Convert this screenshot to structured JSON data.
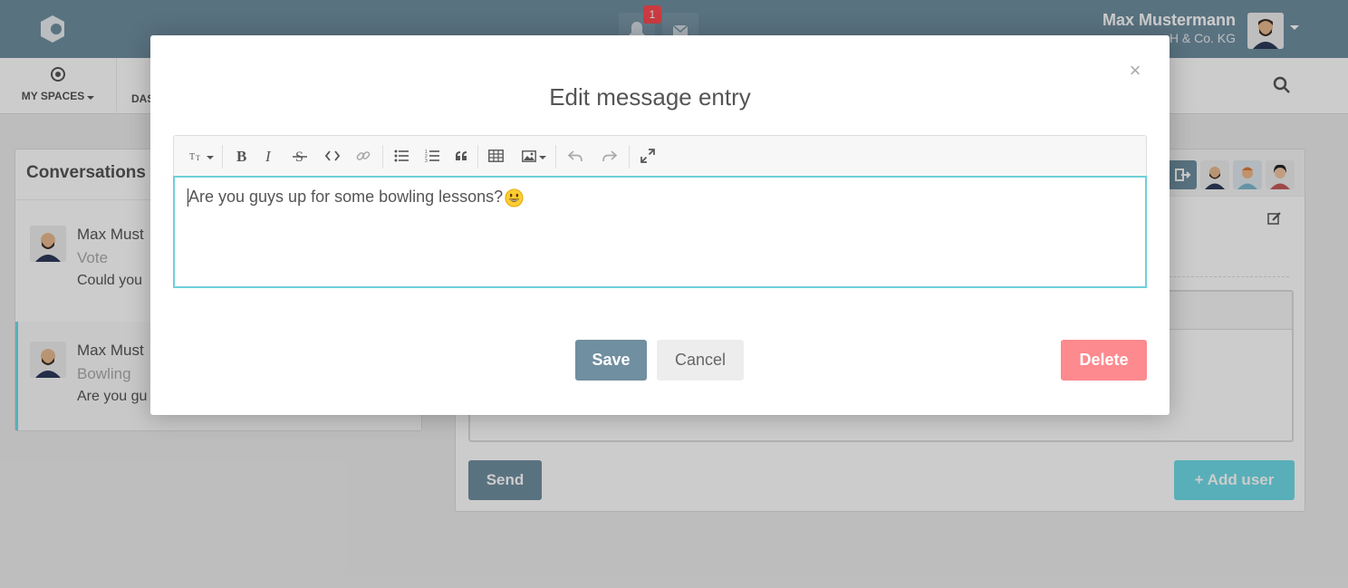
{
  "app": {
    "notification_count": "1",
    "user": {
      "name": "Max Mustermann",
      "org": "H & Co. KG"
    },
    "nav": {
      "my_spaces": "MY SPACES",
      "dashboard_partial": "DAS"
    }
  },
  "conversations": {
    "header": "Conversations",
    "items": [
      {
        "name": "Max Must",
        "title": "Vote",
        "preview": "Could you"
      },
      {
        "name": "Max Must",
        "title": "Bowling",
        "preview": "Are you gu"
      }
    ]
  },
  "chat_panel": {
    "send_label": "Send",
    "add_user_label": "+ Add user"
  },
  "modal": {
    "title": "Edit message entry",
    "close": "×",
    "message": "Are you guys up for some bowling lessons?",
    "toolbar": [
      "text-size",
      "bold",
      "italic",
      "strikethrough",
      "code",
      "link",
      "bullet-list",
      "numbered-list",
      "quote",
      "table",
      "image",
      "undo",
      "redo",
      "fullscreen"
    ],
    "save_label": "Save",
    "cancel_label": "Cancel",
    "delete_label": "Delete"
  },
  "colors": {
    "topbar": "#708fa0",
    "accent": "#6fdbe8",
    "danger": "#fc8a8e"
  }
}
